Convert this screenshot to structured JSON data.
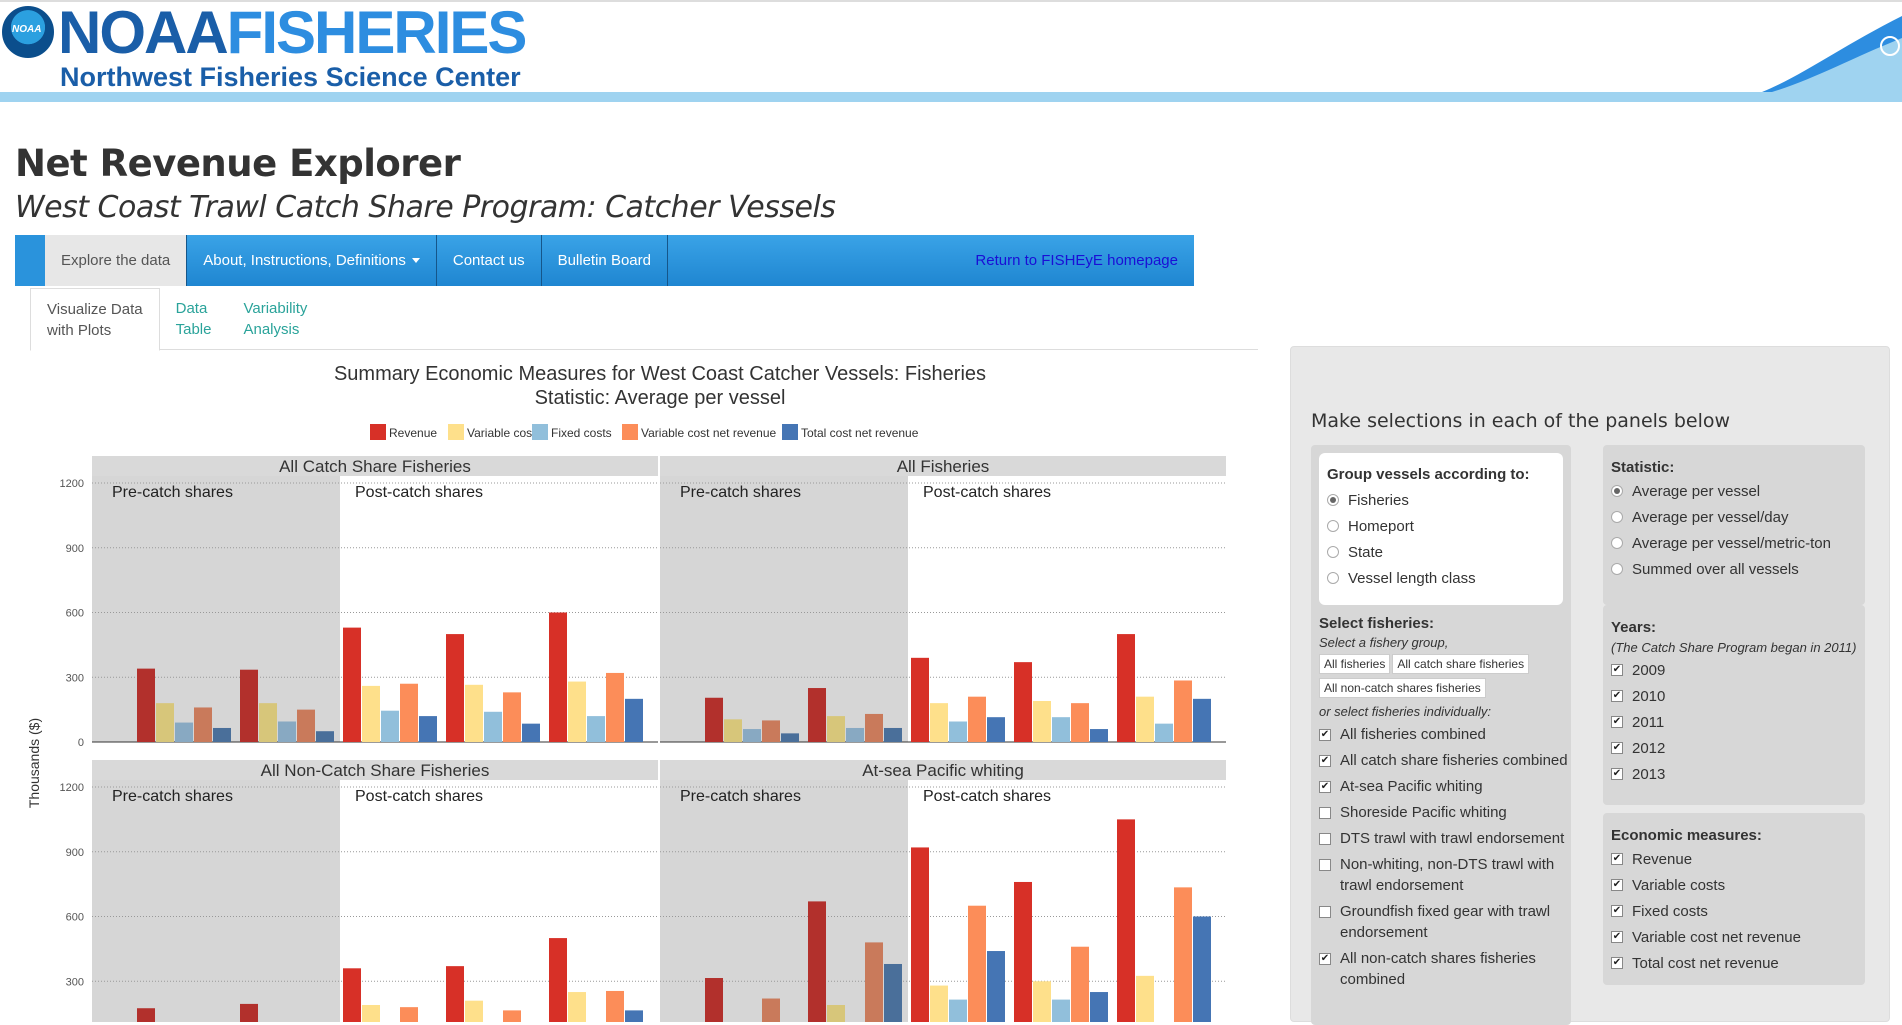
{
  "header": {
    "brand_left": "NOAA",
    "brand_right": "FISHERIES",
    "brand_sub": "Northwest Fisheries Science Center",
    "logo_text": "NOAA"
  },
  "app": {
    "title": "Net Revenue Explorer",
    "subtitle": "West Coast Trawl Catch Share Program: Catcher Vessels"
  },
  "navbar": {
    "items": [
      "Explore the data",
      "About, Instructions, Definitions",
      "Contact us",
      "Bulletin Board"
    ],
    "return_link": "Return to FISHEyE homepage"
  },
  "tabs": [
    {
      "label": "Visualize Data with Plots",
      "line1": "Visualize Data",
      "line2": "with Plots"
    },
    {
      "label": "Data Table",
      "line1": "Data",
      "line2": "Table"
    },
    {
      "label": "Variability Analysis",
      "line1": "Variability",
      "line2": "Analysis"
    }
  ],
  "sidebar": {
    "heading": "Make selections in each of the panels below",
    "group": {
      "title": "Group vessels according to:",
      "options": [
        "Fisheries",
        "Homeport",
        "State",
        "Vessel length class"
      ],
      "selected": 0
    },
    "fisheries": {
      "title": "Select fisheries:",
      "hint1": "Select a fishery group,",
      "pills": [
        "All fisheries",
        "All catch share fisheries",
        "All non-catch shares fisheries"
      ],
      "hint2": "or select fisheries individually:",
      "items": [
        {
          "label": "All fisheries combined",
          "checked": true
        },
        {
          "label": "All catch share fisheries combined",
          "checked": true
        },
        {
          "label": "At-sea Pacific whiting",
          "checked": true
        },
        {
          "label": "Shoreside Pacific whiting",
          "checked": false
        },
        {
          "label": "DTS trawl with trawl endorsement",
          "checked": false
        },
        {
          "label": "Non-whiting, non-DTS trawl with trawl endorsement",
          "checked": false
        },
        {
          "label": "Groundfish fixed gear with trawl endorsement",
          "checked": false
        },
        {
          "label": "All non-catch shares fisheries combined",
          "checked": true
        }
      ]
    },
    "statistic": {
      "title": "Statistic:",
      "options": [
        "Average per vessel",
        "Average per vessel/day",
        "Average per vessel/metric-ton",
        "Summed over all vessels"
      ],
      "selected": 0
    },
    "years": {
      "title": "Years:",
      "hint": "(The Catch Share Program began in 2011)",
      "items": [
        "2009",
        "2010",
        "2011",
        "2012",
        "2013"
      ]
    },
    "measures": {
      "title": "Economic measures:",
      "items": [
        "Revenue",
        "Variable costs",
        "Fixed costs",
        "Variable cost net revenue",
        "Total cost net revenue"
      ]
    }
  },
  "chart_data": {
    "type": "bar",
    "title": "Summary Economic Measures for West Coast Catcher Vessels: Fisheries",
    "subtitle": "Statistic:  Average per vessel",
    "ylabel": "Thousands ($)",
    "ylim": [
      0,
      1200
    ],
    "yticks": [
      0,
      300,
      600,
      900,
      1200
    ],
    "legend_position": "top",
    "series": [
      {
        "name": "Revenue",
        "color": "#d73027"
      },
      {
        "name": "Variable costs",
        "color": "#fee08b"
      },
      {
        "name": "Fixed costs",
        "color": "#91bfdb"
      },
      {
        "name": "Variable cost net revenue",
        "color": "#fc8d59"
      },
      {
        "name": "Total cost net revenue",
        "color": "#4575b4"
      }
    ],
    "period_labels": [
      "Pre-catch shares",
      "Post-catch shares"
    ],
    "years": [
      "2009",
      "2010",
      "2011",
      "2012",
      "2013"
    ],
    "panels": [
      {
        "name": "All Catch Share Fisheries",
        "values": [
          [
            340,
            180,
            90,
            160,
            65
          ],
          [
            335,
            180,
            95,
            150,
            50
          ],
          [
            530,
            260,
            145,
            270,
            120
          ],
          [
            500,
            265,
            140,
            230,
            85
          ],
          [
            600,
            280,
            120,
            320,
            200
          ]
        ]
      },
      {
        "name": "All Fisheries",
        "values": [
          [
            205,
            105,
            60,
            100,
            40
          ],
          [
            250,
            120,
            65,
            130,
            65
          ],
          [
            390,
            180,
            95,
            210,
            115
          ],
          [
            370,
            190,
            115,
            180,
            60
          ],
          [
            500,
            210,
            85,
            285,
            200
          ]
        ]
      },
      {
        "name": "All Non-Catch Share Fisheries",
        "values": [
          [
            175,
            0,
            0,
            0,
            0
          ],
          [
            195,
            0,
            0,
            0,
            0
          ],
          [
            360,
            190,
            0,
            180,
            0
          ],
          [
            370,
            210,
            0,
            165,
            0
          ],
          [
            500,
            250,
            0,
            255,
            165
          ]
        ]
      },
      {
        "name": "At-sea Pacific whiting",
        "values": [
          [
            315,
            0,
            0,
            220,
            0
          ],
          [
            670,
            190,
            0,
            480,
            380
          ],
          [
            920,
            280,
            215,
            650,
            440
          ],
          [
            760,
            300,
            215,
            460,
            250
          ],
          [
            1050,
            325,
            0,
            735,
            600
          ]
        ]
      }
    ]
  }
}
